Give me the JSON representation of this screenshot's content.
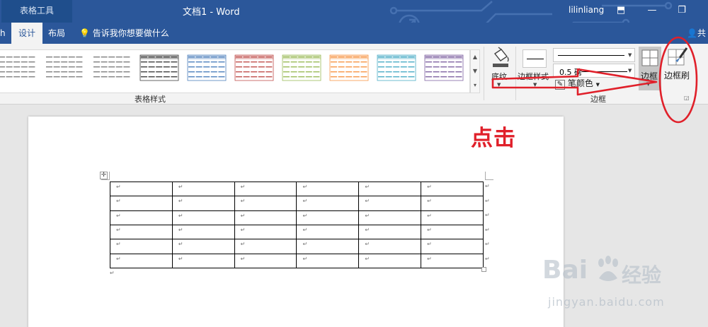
{
  "titlebar": {
    "context_tab": "表格工具",
    "doc_title": "文档1  -  Word",
    "user_name": "lilinliang"
  },
  "tabs": {
    "partial": "h",
    "design": "设计",
    "layout": "布局",
    "tell_me": "告诉我你想要做什么",
    "share": "共"
  },
  "ribbon": {
    "table_styles_group": "表格样式",
    "shading_label": "底纹",
    "border_styles_label": "边框样式",
    "line_weight": "0.5 磅",
    "pen_color": "笔颜色",
    "borders_label": "边框",
    "border_painter_label": "边框刷",
    "borders_group": "边框",
    "style_accents": [
      "#7f7f7f",
      "#7f7f7f",
      "#7f7f7f",
      "#404040",
      "#4f81bd",
      "#c0504d",
      "#9bbb59",
      "#f79646",
      "#4bacc6",
      "#8064a2"
    ]
  },
  "document": {
    "cell_mark": "↵",
    "rows": 6,
    "cols": 6
  },
  "annotation": {
    "click_text": "点击",
    "color": "#e0202a"
  },
  "watermark": {
    "brand": "Bai",
    "brand_cn": "经验",
    "url": "jingyan.baidu.com"
  }
}
